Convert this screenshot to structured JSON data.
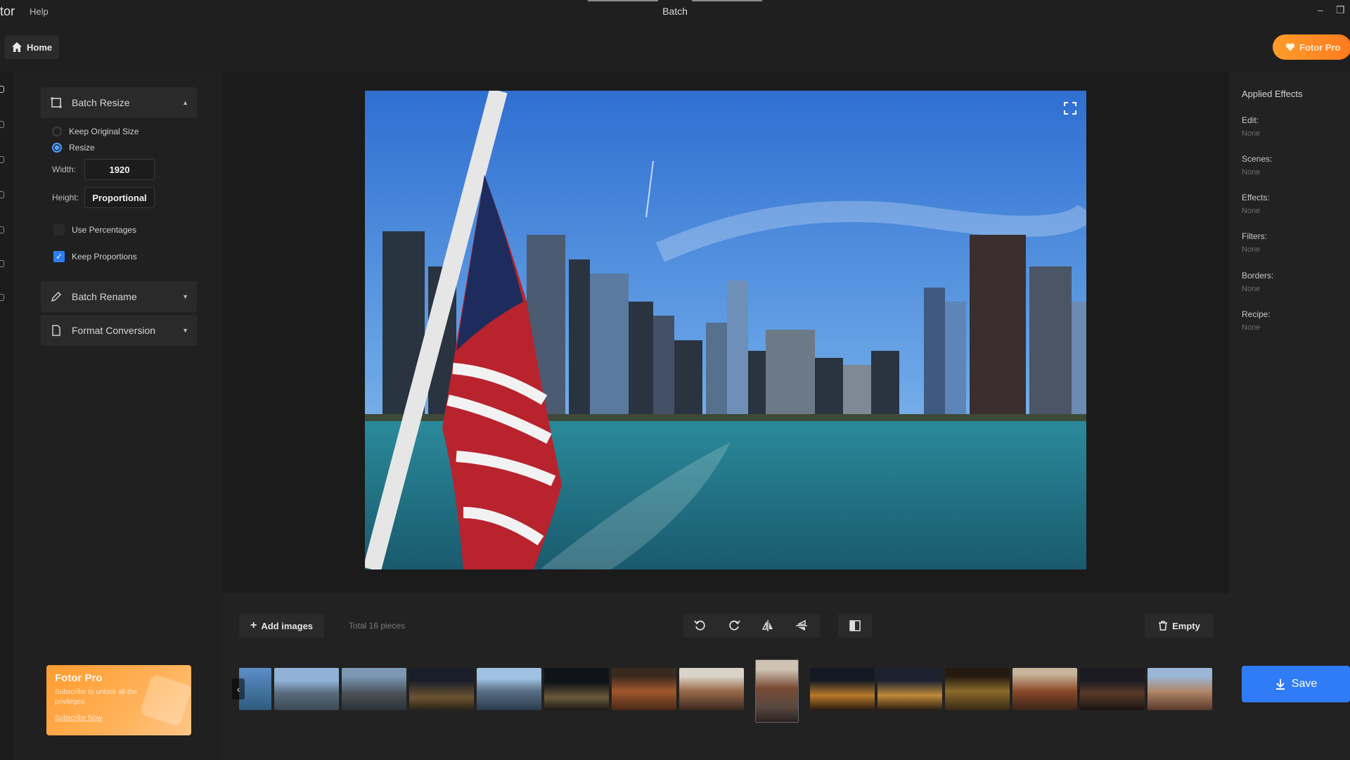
{
  "titlebar": {
    "app_name": "tor",
    "help": "Help",
    "title": "Batch",
    "minimize": "–",
    "restore": "❐"
  },
  "topbar": {
    "home": "Home",
    "pro_button": "Fotor Pro"
  },
  "left_panel": {
    "batch_resize": {
      "label": "Batch Resize",
      "keep_original": "Keep Original Size",
      "resize": "Resize",
      "width_label": "Width:",
      "width_value": "1920",
      "height_label": "Height:",
      "height_value": "Proportional",
      "use_percentages": "Use Percentages",
      "keep_proportions": "Keep Proportions",
      "selected_mode": "Resize",
      "use_percentages_checked": false,
      "keep_proportions_checked": true
    },
    "batch_rename": {
      "label": "Batch Rename"
    },
    "format_conversion": {
      "label": "Format Conversion"
    },
    "promo": {
      "title": "Fotor Pro",
      "subtitle": "Subscribe to unlock all the privileges",
      "link": "Subscribe Now"
    }
  },
  "right_panel": {
    "title": "Applied Effects",
    "items": [
      {
        "label": "Edit:",
        "value": "None"
      },
      {
        "label": "Scenes:",
        "value": "None"
      },
      {
        "label": "Effects:",
        "value": "None"
      },
      {
        "label": "Filters:",
        "value": "None"
      },
      {
        "label": "Borders:",
        "value": "None"
      },
      {
        "label": "Recipe:",
        "value": "None"
      }
    ]
  },
  "bottom": {
    "add_images": "Add images",
    "total": "Total 16 pieces",
    "empty": "Empty",
    "save": "Save"
  },
  "colors": {
    "accent_blue": "#2f7cf6",
    "pro_orange": "#ff8a24",
    "bg_dark": "#1e1e1e"
  }
}
